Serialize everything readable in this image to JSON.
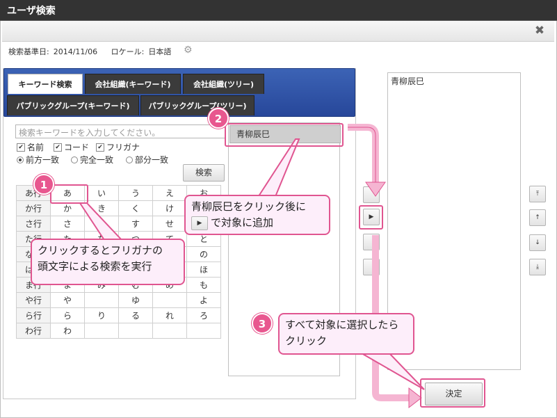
{
  "window": {
    "title": "ユーザ検索",
    "close_icon": "✖"
  },
  "meta": {
    "base_date_label": "検索基準日:",
    "base_date": "2014/11/06",
    "locale_label": "ロケール:",
    "locale": "日本語"
  },
  "tabs": [
    {
      "label": "キーワード検索",
      "active": true
    },
    {
      "label": "会社組織(キーワード)",
      "active": false
    },
    {
      "label": "会社組織(ツリー)",
      "active": false
    },
    {
      "label": "パブリックグループ(キーワード)",
      "active": false
    },
    {
      "label": "パブリックグループ(ツリー)",
      "active": false
    }
  ],
  "search": {
    "placeholder": "検索キーワードを入力してください。",
    "fields": [
      "名前",
      "コード",
      "フリガナ"
    ],
    "match_modes": [
      "前方一致",
      "完全一致",
      "部分一致"
    ],
    "button": "検索"
  },
  "kana_rows": [
    {
      "head": "あ行",
      "cells": [
        "あ",
        "い",
        "う",
        "え",
        "お"
      ]
    },
    {
      "head": "か行",
      "cells": [
        "か",
        "き",
        "く",
        "け",
        "こ"
      ]
    },
    {
      "head": "さ行",
      "cells": [
        "さ",
        "し",
        "す",
        "せ",
        "そ"
      ]
    },
    {
      "head": "た行",
      "cells": [
        "た",
        "ち",
        "つ",
        "て",
        "と"
      ]
    },
    {
      "head": "な行",
      "cells": [
        "な",
        "に",
        "ぬ",
        "ね",
        "の"
      ]
    },
    {
      "head": "は行",
      "cells": [
        "は",
        "ひ",
        "ふ",
        "へ",
        "ほ"
      ]
    },
    {
      "head": "ま行",
      "cells": [
        "ま",
        "み",
        "む",
        "め",
        "も"
      ]
    },
    {
      "head": "や行",
      "cells": [
        "や",
        "",
        "ゆ",
        "",
        "よ"
      ]
    },
    {
      "head": "ら行",
      "cells": [
        "ら",
        "り",
        "る",
        "れ",
        "ろ"
      ]
    },
    {
      "head": "わ行",
      "cells": [
        "わ",
        "",
        "",
        "",
        ""
      ]
    }
  ],
  "results": {
    "item": "青柳辰巳"
  },
  "selected": {
    "item": "青柳辰巳"
  },
  "decide_button": "決定",
  "callouts": {
    "c1": {
      "num": "1",
      "line1": "クリックするとフリガナの",
      "line2": "頭文字による検索を実行"
    },
    "c2": {
      "num": "2",
      "line1": "青柳辰巳をクリック後に",
      "line2": "で対象に追加"
    },
    "c3": {
      "num": "3",
      "line1": "すべて対象に選択したら",
      "line2": "クリック"
    }
  },
  "colors": {
    "accent": "#e05590",
    "tab_bg": "#2d50a8",
    "titlebar": "#333333"
  }
}
